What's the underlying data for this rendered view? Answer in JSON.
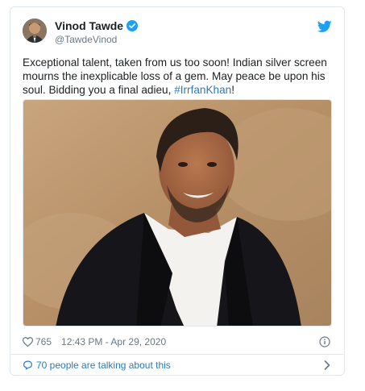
{
  "tweet": {
    "display_name": "Vinod Tawde",
    "handle": "@TawdeVinod",
    "text_main": "Exceptional talent, taken from us too soon! Indian silver screen mourns the inexplicable loss of a gem. May peace be upon his soul. Bidding you a final adieu, ",
    "hashtag": "#IrrfanKhan",
    "text_end": "!",
    "like_count": "765",
    "timestamp": "12:43 PM - Apr 29, 2020",
    "conversation_label": "70 people are talking about this"
  },
  "icons": {
    "verified": "verified-badge-icon",
    "brand": "twitter-bird-icon",
    "like": "heart-icon",
    "info": "info-icon",
    "conversation": "chat-bubble-icon",
    "navigate": "chevron-right-icon"
  },
  "colors": {
    "link": "#2b7bb9",
    "verified": "#1da1f2",
    "muted": "#697882",
    "border": "#e1e8ed"
  }
}
